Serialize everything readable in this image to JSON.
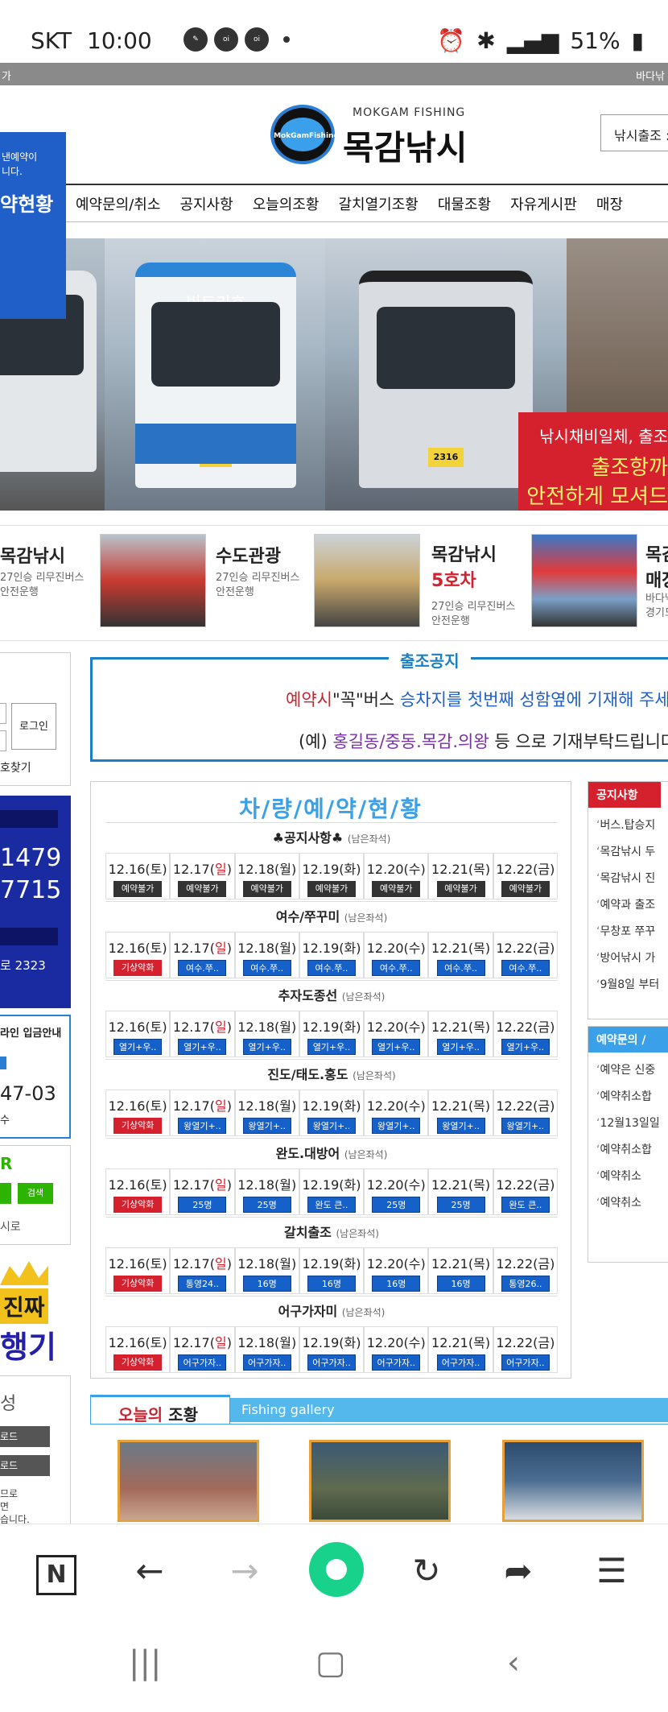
{
  "status": {
    "carrier": "SKT",
    "time": "10:00",
    "notif_icons": [
      "pen-icon",
      "oi-lock-icon",
      "oi-lock-icon"
    ],
    "battery": "51%"
  },
  "topstrip": {
    "left": "가",
    "right": "바다낚"
  },
  "header": {
    "blue_small_1": "낸예약이",
    "blue_small_2": "니다.",
    "blue_big": "약현황",
    "logo_text": "MokGamFishing",
    "brand_en": "MOKGAM FISHING",
    "brand_ko": "목감낚시",
    "right_button": "낚시출조 :"
  },
  "nav": [
    "예약문의/취소",
    "공지사항",
    "오늘의조황",
    "갈치열기조황",
    "대물조황",
    "자유게시판",
    "매장"
  ],
  "banner": {
    "bus2_title": "빅토리호",
    "bus2_plate": "7952",
    "bus3_plate": "2316",
    "red_line1": "낚시채비일체, 출조",
    "red_line2": "출조항까",
    "red_line3": "안전하게 모셔드"
  },
  "buses": [
    {
      "name": "목감낚시",
      "desc1": "27인승 리무진버스",
      "desc2": "안전운행"
    },
    {
      "name": "수도관광",
      "desc1": "27인승 리무진버스",
      "desc2": "안전운행"
    },
    {
      "name": "목감낚시",
      "name2": "5호차",
      "desc1": "27인승 리무진버스",
      "desc2": "안전운행"
    },
    {
      "name": "목감",
      "name2": "매장",
      "desc1": "바다낚",
      "desc2": "경기도"
    }
  ],
  "sidebar": {
    "login_button": "로그인",
    "find": "호찾기",
    "phone1": "1479",
    "phone2": "7715",
    "phone3": "로 2323",
    "bank_title": "라인 입금안내",
    "bank_number": "47-03",
    "bank_sub": "수",
    "search_logo": "R",
    "search_btn": "검색",
    "search_sub": "시로",
    "promo1": "진짜",
    "promo2": "행기",
    "menu_head": "성",
    "menu_d1": "로드",
    "menu_d2": "로드",
    "menu_text1": "므로",
    "menu_text2": "면",
    "menu_text3": "습니다."
  },
  "notice": {
    "title": "출조공지",
    "l1_a": "예약시",
    "l1_b": "\"꼭\"버스 ",
    "l1_c": "승차지를 첫번째 성함옆에 기재해 주세요",
    "l2_a": "(예) ",
    "l2_b": "홍길동/중동.목감.의왕",
    "l2_c": " 등 으로 기재부탁드립니다"
  },
  "reservation": {
    "title": "차/량/예/약/현/황",
    "sections": [
      {
        "name": "♣공지사항♣",
        "sub": "(남은좌석)",
        "cells": [
          {
            "d": "12.16(",
            "w": "토",
            "e": ")",
            "b": "예약불가",
            "c": "dark"
          },
          {
            "d": "12.17(",
            "w": "일",
            "sun": true,
            "e": ")",
            "b": "예약불가",
            "c": "dark"
          },
          {
            "d": "12.18(",
            "w": "월",
            "e": ")",
            "b": "예약불가",
            "c": "dark"
          },
          {
            "d": "12.19(",
            "w": "화",
            "e": ")",
            "b": "예약불가",
            "c": "dark"
          },
          {
            "d": "12.20(",
            "w": "수",
            "e": ")",
            "b": "예약불가",
            "c": "dark"
          },
          {
            "d": "12.21(",
            "w": "목",
            "e": ")",
            "b": "예약불가",
            "c": "dark"
          },
          {
            "d": "12.22(",
            "w": "금",
            "e": ")",
            "b": "예약불가",
            "c": "dark"
          }
        ]
      },
      {
        "name": "여수/쭈꾸미",
        "sub": "(남은좌석)",
        "cells": [
          {
            "d": "12.16(",
            "w": "토",
            "e": ")",
            "b": "기상악화",
            "c": "red"
          },
          {
            "d": "12.17(",
            "w": "일",
            "sun": true,
            "e": ")",
            "b": "여수.쭈..",
            "c": "blue"
          },
          {
            "d": "12.18(",
            "w": "월",
            "e": ")",
            "b": "여수.쭈..",
            "c": "blue"
          },
          {
            "d": "12.19(",
            "w": "화",
            "e": ")",
            "b": "여수.쭈..",
            "c": "blue"
          },
          {
            "d": "12.20(",
            "w": "수",
            "e": ")",
            "b": "여수.쭈..",
            "c": "blue"
          },
          {
            "d": "12.21(",
            "w": "목",
            "e": ")",
            "b": "여수.쭈..",
            "c": "blue"
          },
          {
            "d": "12.22(",
            "w": "금",
            "e": ")",
            "b": "여수.쭈..",
            "c": "blue"
          }
        ]
      },
      {
        "name": "추자도종선",
        "sub": "(남은좌석)",
        "cells": [
          {
            "d": "12.16(",
            "w": "토",
            "e": ")",
            "b": "열기+우..",
            "c": "blue"
          },
          {
            "d": "12.17(",
            "w": "일",
            "sun": true,
            "e": ")",
            "b": "열기+우..",
            "c": "blue"
          },
          {
            "d": "12.18(",
            "w": "월",
            "e": ")",
            "b": "열기+우..",
            "c": "blue"
          },
          {
            "d": "12.19(",
            "w": "화",
            "e": ")",
            "b": "열기+우..",
            "c": "blue"
          },
          {
            "d": "12.20(",
            "w": "수",
            "e": ")",
            "b": "열기+우..",
            "c": "blue"
          },
          {
            "d": "12.21(",
            "w": "목",
            "e": ")",
            "b": "열기+우..",
            "c": "blue"
          },
          {
            "d": "12.22(",
            "w": "금",
            "e": ")",
            "b": "열기+우..",
            "c": "blue"
          }
        ]
      },
      {
        "name": "진도/태도.홍도",
        "sub": "(남은좌석)",
        "cells": [
          {
            "d": "12.16(",
            "w": "토",
            "e": ")",
            "b": "기상악화",
            "c": "red"
          },
          {
            "d": "12.17(",
            "w": "일",
            "sun": true,
            "e": ")",
            "b": "왕열기+..",
            "c": "blue"
          },
          {
            "d": "12.18(",
            "w": "월",
            "e": ")",
            "b": "왕열기+..",
            "c": "blue"
          },
          {
            "d": "12.19(",
            "w": "화",
            "e": ")",
            "b": "왕열기+..",
            "c": "blue"
          },
          {
            "d": "12.20(",
            "w": "수",
            "e": ")",
            "b": "왕열기+..",
            "c": "blue"
          },
          {
            "d": "12.21(",
            "w": "목",
            "e": ")",
            "b": "왕열기+..",
            "c": "blue"
          },
          {
            "d": "12.22(",
            "w": "금",
            "e": ")",
            "b": "왕열기+..",
            "c": "blue"
          }
        ]
      },
      {
        "name": "완도.대방어",
        "sub": "(남은좌석)",
        "cells": [
          {
            "d": "12.16(",
            "w": "토",
            "e": ")",
            "b": "기상악화",
            "c": "red"
          },
          {
            "d": "12.17(",
            "w": "일",
            "sun": true,
            "e": ")",
            "b": "25명",
            "c": "blue"
          },
          {
            "d": "12.18(",
            "w": "월",
            "e": ")",
            "b": "25명",
            "c": "blue"
          },
          {
            "d": "12.19(",
            "w": "화",
            "e": ")",
            "b": "완도 큰..",
            "c": "blue"
          },
          {
            "d": "12.20(",
            "w": "수",
            "e": ")",
            "b": "25명",
            "c": "blue"
          },
          {
            "d": "12.21(",
            "w": "목",
            "e": ")",
            "b": "25명",
            "c": "blue"
          },
          {
            "d": "12.22(",
            "w": "금",
            "e": ")",
            "b": "완도 큰..",
            "c": "blue"
          }
        ]
      },
      {
        "name": "갈치출조",
        "sub": "(남은좌석)",
        "cells": [
          {
            "d": "12.16(",
            "w": "토",
            "e": ")",
            "b": "기상악화",
            "c": "red"
          },
          {
            "d": "12.17(",
            "w": "일",
            "sun": true,
            "e": ")",
            "b": "통영24..",
            "c": "blue"
          },
          {
            "d": "12.18(",
            "w": "월",
            "e": ")",
            "b": "16명",
            "c": "blue"
          },
          {
            "d": "12.19(",
            "w": "화",
            "e": ")",
            "b": "16명",
            "c": "blue"
          },
          {
            "d": "12.20(",
            "w": "수",
            "e": ")",
            "b": "16명",
            "c": "blue"
          },
          {
            "d": "12.21(",
            "w": "목",
            "e": ")",
            "b": "16명",
            "c": "blue"
          },
          {
            "d": "12.22(",
            "w": "금",
            "e": ")",
            "b": "통영26..",
            "c": "blue"
          }
        ]
      },
      {
        "name": "어구가자미",
        "sub": "(남은좌석)",
        "cells": [
          {
            "d": "12.16(",
            "w": "토",
            "e": ")",
            "b": "기상악화",
            "c": "red"
          },
          {
            "d": "12.17(",
            "w": "일",
            "sun": true,
            "e": ")",
            "b": "어구가자..",
            "c": "blue"
          },
          {
            "d": "12.18(",
            "w": "월",
            "e": ")",
            "b": "어구가자..",
            "c": "blue"
          },
          {
            "d": "12.19(",
            "w": "화",
            "e": ")",
            "b": "어구가자..",
            "c": "blue"
          },
          {
            "d": "12.20(",
            "w": "수",
            "e": ")",
            "b": "어구가자..",
            "c": "blue"
          },
          {
            "d": "12.21(",
            "w": "목",
            "e": ")",
            "b": "어구가자..",
            "c": "blue"
          },
          {
            "d": "12.22(",
            "w": "금",
            "e": ")",
            "b": "어구가자..",
            "c": "blue"
          }
        ]
      }
    ]
  },
  "right_notice": {
    "title": "공지사항",
    "items": [
      "버스.탑승지",
      "목감낚시 두",
      "목감낚시 진",
      "예약과 출조",
      "무창포 쭈꾸",
      "방어낚시 가",
      "9월8일 부터"
    ]
  },
  "right_resv": {
    "title": "예약문의 /",
    "items": [
      "예약은 신중",
      "예약취소합",
      "12월13일일",
      "예약취소합",
      "예약취소",
      "예약취소"
    ]
  },
  "gallery": {
    "tab_a": "오늘의",
    "tab_b": " 조황",
    "bar": "Fishing gallery"
  },
  "browser": {
    "n_label": "N"
  },
  "colors": {
    "brand_blue": "#1f5fc7",
    "notice_blue": "#1a7fc4",
    "red": "#d5202e",
    "green": "#18d18a"
  }
}
